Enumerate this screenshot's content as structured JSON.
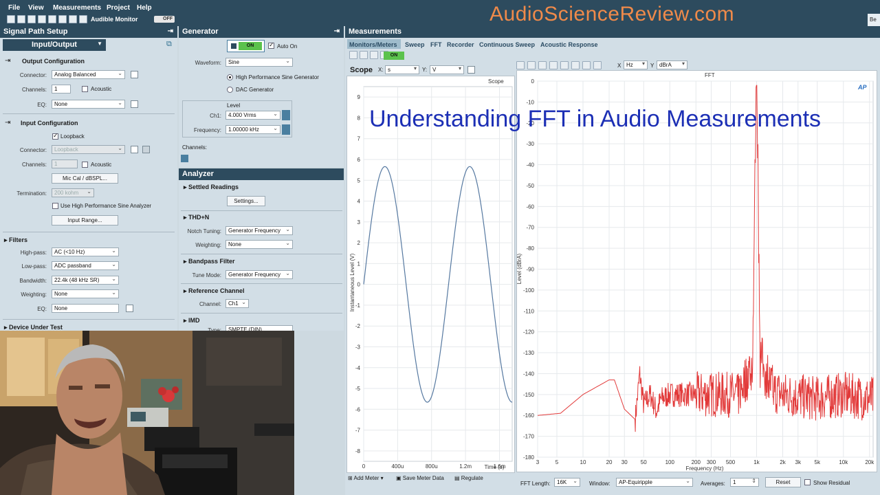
{
  "menubar": {
    "items": [
      "File",
      "View",
      "Measurements",
      "Project",
      "Help"
    ],
    "audible_monitor": "Audible Monitor",
    "audible_state": "OFF"
  },
  "watermark": "AudioScienceReview.com",
  "overlay_title": "Understanding FFT in Audio Measurements",
  "signal_path": {
    "title": "Signal Path Setup",
    "mode": "Input/Output",
    "output_config": "Output Configuration",
    "connector_label": "Connector:",
    "out_connector": "Analog Balanced",
    "channels_label": "Channels:",
    "out_channels": "1",
    "acoustic": "Acoustic",
    "eq_label": "EQ:",
    "out_eq": "None",
    "input_config": "Input Configuration",
    "loopback": "Loopback",
    "in_connector": "Loopback",
    "in_channels": "1",
    "mic_cal": "Mic Cal / dBSPL...",
    "termination_label": "Termination:",
    "termination": "200 kohm",
    "use_hp_sine": "Use High Performance Sine Analyzer",
    "input_range": "Input Range...",
    "filters": "Filters",
    "highpass_label": "High-pass:",
    "highpass": "AC (<10 Hz)",
    "lowpass_label": "Low-pass:",
    "lowpass": "ADC passband",
    "bandwidth_label": "Bandwidth:",
    "bandwidth": "22.4k (48 kHz SR)",
    "weighting_label": "Weighting:",
    "weighting": "None",
    "eq2_label": "EQ:",
    "eq2": "None",
    "dut": "Device Under Test"
  },
  "generator": {
    "title": "Generator",
    "on": "ON",
    "auto_on": "Auto On",
    "waveform_label": "Waveform:",
    "waveform": "Sine",
    "hp_sine": "High Performance Sine Generator",
    "dac_gen": "DAC Generator",
    "level_label": "Level",
    "ch1_label": "Ch1:",
    "ch1": "4.000 Vrms",
    "freq_label": "Frequency:",
    "freq": "1.00000 kHz",
    "channels_label": "Channels:"
  },
  "analyzer": {
    "title": "Analyzer",
    "settled": "Settled Readings",
    "settings": "Settings...",
    "thdn": "THD+N",
    "notch_label": "Notch Tuning:",
    "notch": "Generator Frequency",
    "weighting_label": "Weighting:",
    "weighting": "None",
    "bandpass": "Bandpass Filter",
    "tune_label": "Tune Mode:",
    "tune": "Generator Frequency",
    "refch": "Reference Channel",
    "channel_label": "Channel:",
    "channel": "Ch1",
    "imd": "IMD",
    "type_label": "Type:",
    "type": "SMPTE (DIN)"
  },
  "measurements": {
    "title": "Measurements",
    "tabs": [
      "Monitors/Meters",
      "Sweep",
      "FFT",
      "Recorder",
      "Continuous Sweep",
      "Acoustic Response"
    ],
    "on": "ON",
    "scope": {
      "title": "Scope",
      "x_label": "X:",
      "x_unit": "s",
      "y_label": "Y:",
      "y_unit": "V",
      "plot_title": "Scope",
      "ylabel": "Instantaneous Level (V)",
      "xlabel": "Time (s)",
      "yticks": [
        "9",
        "8",
        "7",
        "6",
        "5",
        "4",
        "3",
        "2",
        "1",
        "0",
        "-1",
        "-2",
        "-3",
        "-4",
        "-5",
        "-6",
        "-7",
        "-8"
      ],
      "xticks": [
        "0",
        "400u",
        "800u",
        "1.2m",
        "1.6m"
      ]
    },
    "fft": {
      "x_label": "X",
      "x_unit": "Hz",
      "y_label": "Y",
      "y_unit": "dBrA",
      "plot_title": "FFT",
      "ylabel": "Level (dBrA)",
      "xlabel": "Frequency (Hz)",
      "logo": "AP",
      "yticks": [
        "0",
        "-10",
        "-20",
        "-30",
        "-40",
        "-50",
        "-60",
        "-70",
        "-80",
        "-90",
        "-100",
        "-110",
        "-120",
        "-130",
        "-140",
        "-150",
        "-160",
        "-170",
        "-180"
      ],
      "xticks": [
        "3",
        "5",
        "10",
        "20",
        "30",
        "50",
        "100",
        "200",
        "300",
        "500",
        "1k",
        "2k",
        "3k",
        "5k",
        "10k",
        "20k"
      ]
    },
    "bottom": {
      "add_meter": "Add Meter",
      "save_meter": "Save Meter Data",
      "regulate": "Regulate",
      "fft_length_label": "FFT Length:",
      "fft_length": "16K",
      "window_label": "Window:",
      "window": "AP-Equiripple",
      "averages_label": "Averages:",
      "averages": "1",
      "reset": "Reset",
      "show_residual": "Show Residual"
    }
  },
  "edge_label": "Be",
  "chart_data": [
    {
      "type": "line",
      "title": "Scope",
      "xlabel": "Time (s)",
      "ylabel": "Instantaneous Level (V)",
      "xlim": [
        0,
        0.00175
      ],
      "ylim": [
        -8.5,
        9.5
      ],
      "series": [
        {
          "amplitude": 5.66,
          "frequency_hz": 1000,
          "x": [
            0,
            0.00025,
            0.00075,
            0.00125,
            0.00175
          ],
          "y": [
            0,
            5.66,
            -5.66,
            5.66,
            -5.3
          ]
        }
      ]
    },
    {
      "type": "line",
      "title": "FFT",
      "xlabel": "Frequency (Hz)",
      "ylabel": "Level (dBrA)",
      "xscale": "log",
      "xlim": [
        3,
        22000
      ],
      "ylim": [
        -180,
        0
      ],
      "series": [
        {
          "x": [
            3,
            5.5,
            10,
            20,
            23,
            30,
            40,
            45,
            50,
            60,
            70,
            80,
            100,
            200,
            500,
            900,
            1000,
            1100,
            2000,
            5000,
            10000,
            20000
          ],
          "y": [
            -160,
            -159,
            -150,
            -143,
            -143,
            -157,
            -162,
            -140,
            -155,
            -150,
            -158,
            -152,
            -150,
            -150,
            -150,
            -148,
            -2,
            -145,
            -150,
            -152,
            -150,
            -152
          ]
        }
      ]
    }
  ]
}
